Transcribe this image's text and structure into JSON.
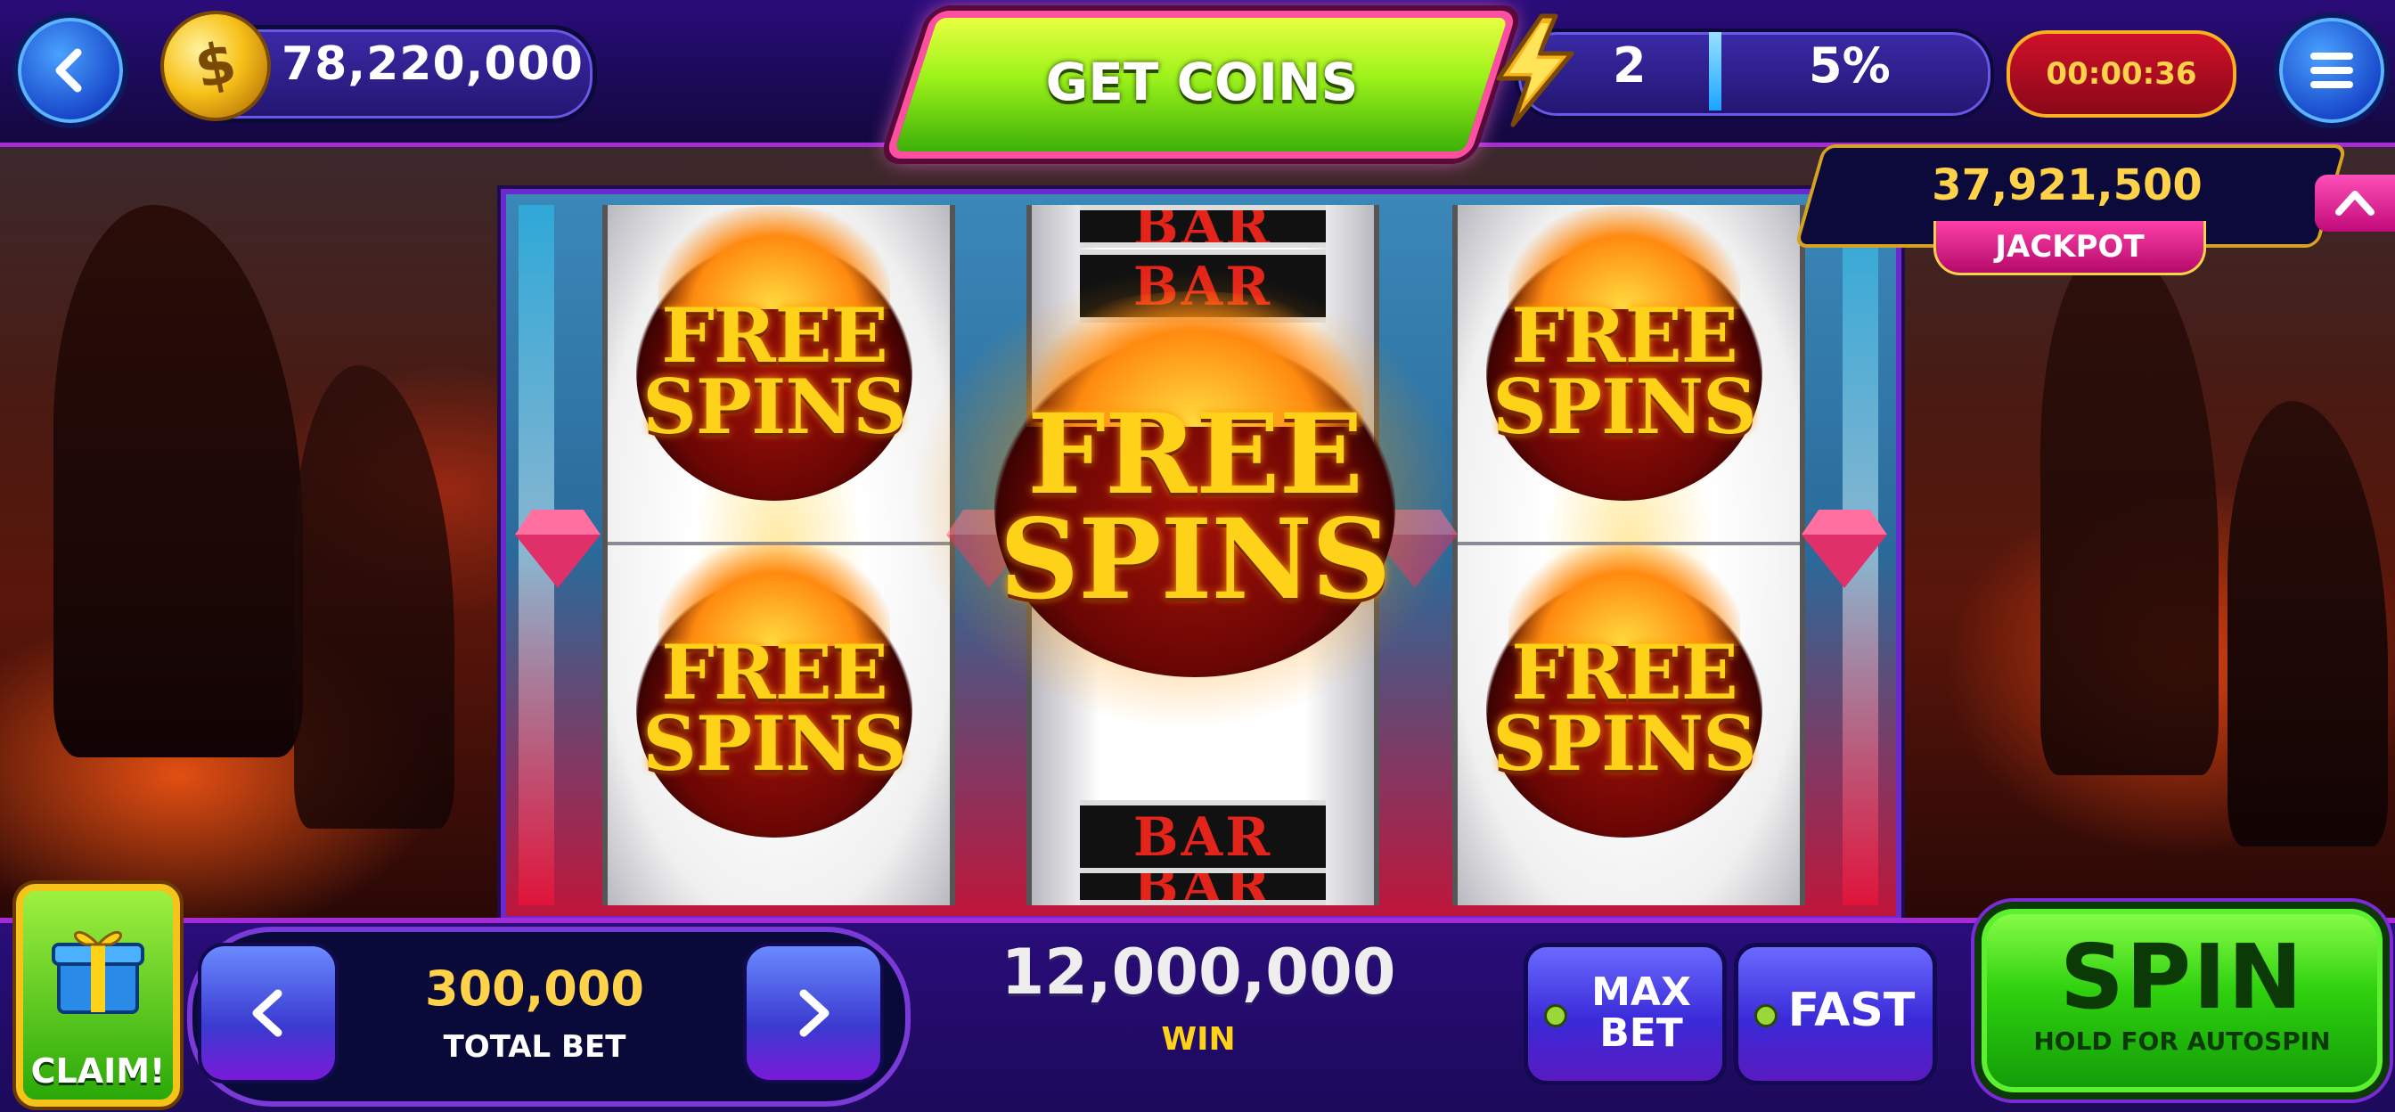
{
  "top_bar": {
    "back_icon": "chevron-left-icon",
    "coin_icon": "coin-icon",
    "coin_symbol": "$",
    "balance": "78,220,000",
    "get_coins_label": "GET COINS",
    "level_icon": "lightning-bolt-icon",
    "level": "2",
    "level_progress": "5%",
    "level_progress_fraction": 0.05,
    "timer": "00:00:36",
    "menu_icon": "hamburger-menu-icon"
  },
  "jackpot": {
    "value": "37,921,500",
    "label": "JACKPOT",
    "collapse_icon": "chevron-up-icon"
  },
  "reels": {
    "symbol_free_line1": "FREE",
    "symbol_free_line2": "SPINS",
    "symbol_bar": "BAR",
    "columns": [
      [
        "FREE SPINS",
        "FREE SPINS"
      ],
      [
        "BAR",
        "FREE SPINS",
        "BAR"
      ],
      [
        "FREE SPINS",
        "FREE SPINS"
      ]
    ],
    "gem_icon": "diamond-gem-icon"
  },
  "bottom_bar": {
    "claim_label": "CLAIM!",
    "gift_icon": "gift-box-icon",
    "bet_decrease_icon": "chevron-left-icon",
    "bet_increase_icon": "chevron-right-icon",
    "total_bet": "300,000",
    "total_bet_label": "TOTAL BET",
    "win_amount": "12,000,000",
    "win_label": "WIN",
    "max_bet_line1": "MAX",
    "max_bet_line2": "BET",
    "fast_label": "FAST",
    "spin_label": "SPIN",
    "spin_sub_label": "HOLD FOR AUTOSPIN"
  },
  "colors": {
    "accent_purple": "#a52bd6",
    "gold_text": "#ffd24a",
    "spin_green": "#2ed00e",
    "jackpot_pink": "#ff3fa8"
  }
}
